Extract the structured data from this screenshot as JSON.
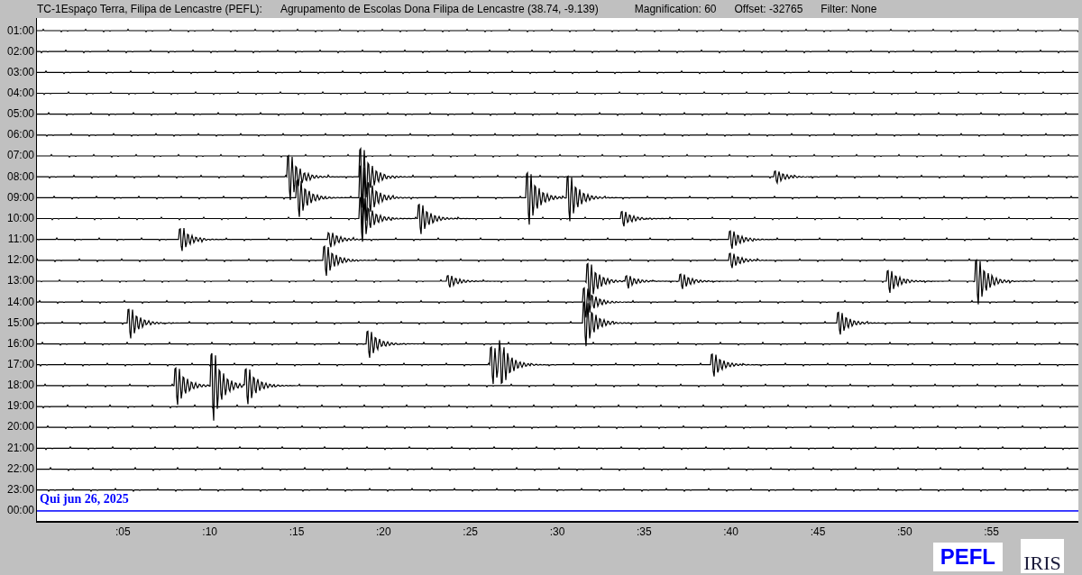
{
  "header": {
    "station": "TC-1Espaço Terra, Filipa de Lencastre (PEFL):",
    "location": "Agrupamento de Escolas Dona Filipa de Lencastre (38.74, -9.139)",
    "magnification": "Magnification: 60",
    "offset": "Offset: -32765",
    "filter": "Filter: None"
  },
  "rows": [
    {
      "label": "01:00",
      "current": false
    },
    {
      "label": "02:00",
      "current": false
    },
    {
      "label": "03:00",
      "current": false
    },
    {
      "label": "04:00",
      "current": false
    },
    {
      "label": "05:00",
      "current": false
    },
    {
      "label": "06:00",
      "current": false
    },
    {
      "label": "07:00",
      "current": false
    },
    {
      "label": "08:00",
      "current": false
    },
    {
      "label": "09:00",
      "current": false
    },
    {
      "label": "10:00",
      "current": false
    },
    {
      "label": "11:00",
      "current": false
    },
    {
      "label": "12:00",
      "current": false
    },
    {
      "label": "13:00",
      "current": false
    },
    {
      "label": "14:00",
      "current": false
    },
    {
      "label": "15:00",
      "current": false
    },
    {
      "label": "16:00",
      "current": false
    },
    {
      "label": "17:00",
      "current": false
    },
    {
      "label": "18:00",
      "current": false
    },
    {
      "label": "19:00",
      "current": false
    },
    {
      "label": "20:00",
      "current": false
    },
    {
      "label": "21:00",
      "current": false
    },
    {
      "label": "22:00",
      "current": false
    },
    {
      "label": "23:00",
      "current": false
    },
    {
      "label": "00:00",
      "current": true
    }
  ],
  "date": "Qui jun 26, 2025",
  "x_ticks": [
    ":05",
    ":10",
    ":15",
    ":20",
    ":25",
    ":30",
    ":35",
    ":40",
    ":45",
    ":50",
    ":55"
  ],
  "logos": {
    "station": "PEFL",
    "network": "IRIS"
  }
}
